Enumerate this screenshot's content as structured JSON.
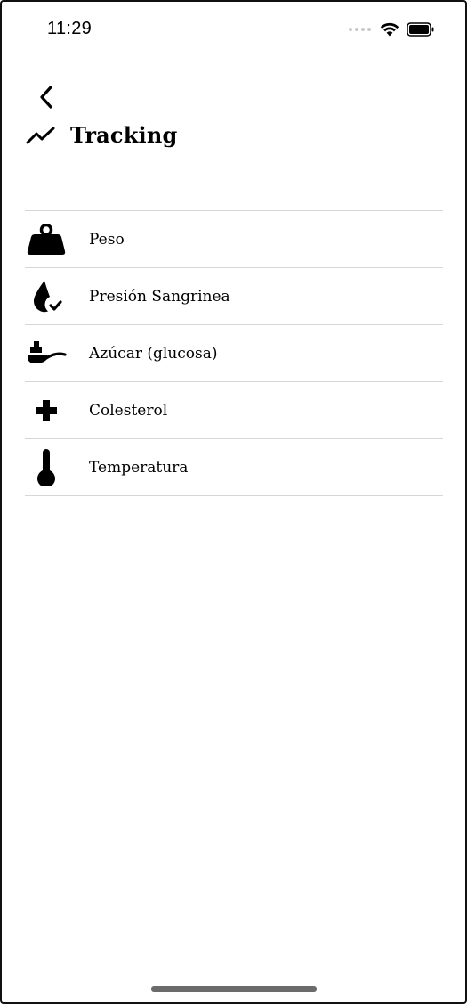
{
  "status_bar": {
    "time": "11:29",
    "icons": [
      "signal-dots-icon",
      "wifi-icon",
      "battery-icon"
    ]
  },
  "nav": {
    "back_icon": "chevron-left-icon"
  },
  "header": {
    "icon": "trending-up-icon",
    "title": "Tracking"
  },
  "items": [
    {
      "label": "Peso",
      "icon": "weight-icon"
    },
    {
      "label": "Presión Sangrinea",
      "icon": "blood-drop-check-icon"
    },
    {
      "label": "Azúcar (glucosa)",
      "icon": "sugar-spoon-icon"
    },
    {
      "label": "Colesterol",
      "icon": "plus-cross-icon"
    },
    {
      "label": "Temperatura",
      "icon": "thermometer-icon"
    }
  ],
  "colors": {
    "background": "#ffffff",
    "divider": "#d6d6d6",
    "home_indicator": "#6b6b6b"
  }
}
